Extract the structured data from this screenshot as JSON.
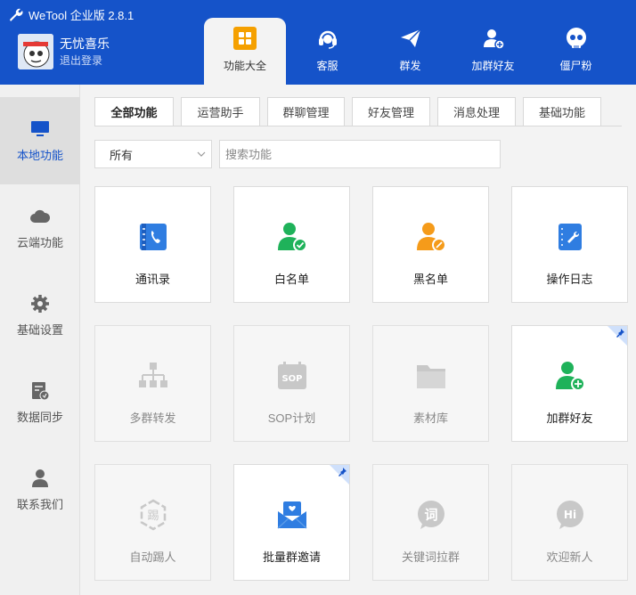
{
  "app": {
    "title": "WeTool 企业版 2.8.1"
  },
  "user": {
    "name": "无忧喜乐",
    "logout": "退出登录"
  },
  "nav": [
    {
      "label": "功能大全",
      "icon": "grid-icon",
      "active": true
    },
    {
      "label": "客服",
      "icon": "headset-icon"
    },
    {
      "label": "群发",
      "icon": "paper-plane-icon"
    },
    {
      "label": "加群好友",
      "icon": "add-user-icon"
    },
    {
      "label": "僵尸粉",
      "icon": "skull-icon"
    }
  ],
  "sidebar": [
    {
      "label": "本地功能",
      "icon": "monitor-icon",
      "active": true
    },
    {
      "label": "云端功能",
      "icon": "cloud-icon"
    },
    {
      "label": "基础设置",
      "icon": "gear-icon"
    },
    {
      "label": "数据同步",
      "icon": "sync-doc-icon"
    },
    {
      "label": "联系我们",
      "icon": "person-icon"
    }
  ],
  "tabs": [
    {
      "label": "全部功能",
      "active": true
    },
    {
      "label": "运营助手"
    },
    {
      "label": "群聊管理"
    },
    {
      "label": "好友管理"
    },
    {
      "label": "消息处理"
    },
    {
      "label": "基础功能"
    }
  ],
  "filter": {
    "selected": "所有",
    "search_placeholder": "搜索功能"
  },
  "cards": [
    {
      "label": "通讯录",
      "icon": "contacts-book-icon",
      "enabled": true
    },
    {
      "label": "白名单",
      "icon": "whitelist-user-icon",
      "enabled": true
    },
    {
      "label": "黑名单",
      "icon": "blacklist-user-icon",
      "enabled": true
    },
    {
      "label": "操作日志",
      "icon": "log-book-icon",
      "enabled": true
    },
    {
      "label": "多群转发",
      "icon": "org-tree-icon",
      "enabled": false
    },
    {
      "label": "SOP计划",
      "icon": "sop-calendar-icon",
      "enabled": false
    },
    {
      "label": "素材库",
      "icon": "folder-icon",
      "enabled": false
    },
    {
      "label": "加群好友",
      "icon": "add-friend-icon",
      "enabled": true,
      "pinned": true
    },
    {
      "label": "自动踢人",
      "icon": "kick-icon",
      "enabled": false
    },
    {
      "label": "批量群邀请",
      "icon": "invite-mail-icon",
      "enabled": true,
      "pinned": true
    },
    {
      "label": "关键词拉群",
      "icon": "keyword-icon",
      "enabled": false
    },
    {
      "label": "欢迎新人",
      "icon": "hi-bubble-icon",
      "enabled": false
    }
  ],
  "colors": {
    "brand": "#1553c9",
    "green": "#1fb25a",
    "orange": "#f59b1a",
    "blue": "#2f7de1"
  }
}
